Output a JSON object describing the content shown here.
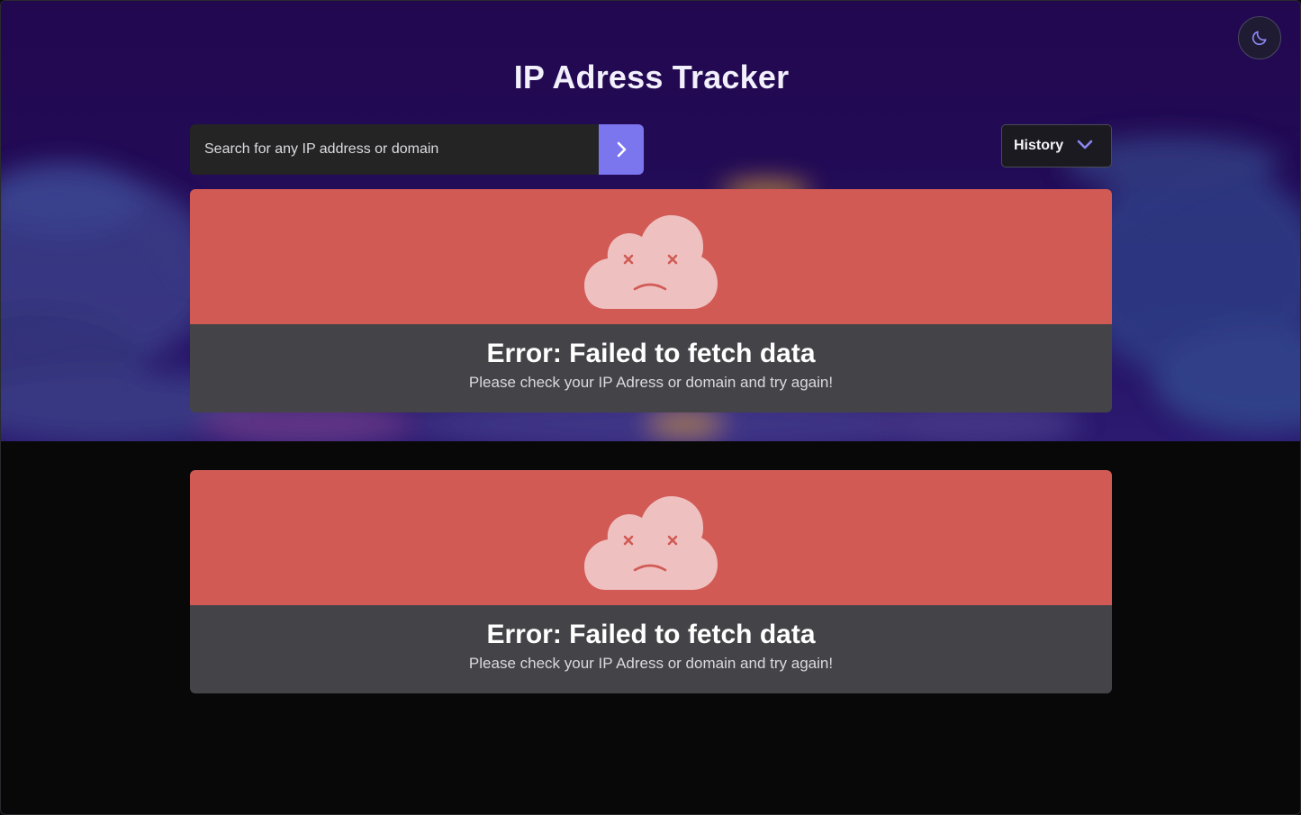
{
  "header": {
    "title": "IP Adress Tracker",
    "theme_toggle_icon": "moon-icon"
  },
  "search": {
    "placeholder": "Search for any IP address or domain",
    "value": "",
    "submit_icon": "chevron-right-icon"
  },
  "history": {
    "label": "History",
    "icon": "chevron-down-icon"
  },
  "errors": [
    {
      "icon": "sad-cloud-icon",
      "title": "Error: Failed to fetch data",
      "message": "Please check your IP Adress or domain and try again!"
    },
    {
      "icon": "sad-cloud-icon",
      "title": "Error: Failed to fetch data",
      "message": "Please check your IP Adress or domain and try again!"
    }
  ],
  "colors": {
    "hero_background": "#22084f",
    "accent": "#7b75ee",
    "error_banner": "#d15a55",
    "card_body": "#444448",
    "page_background": "#080808"
  }
}
